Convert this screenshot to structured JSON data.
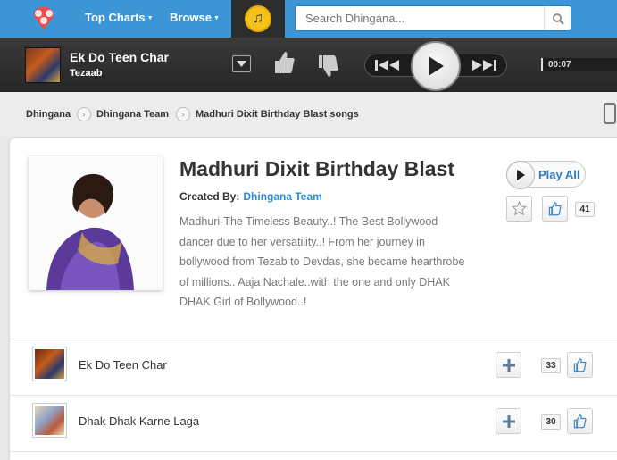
{
  "nav": {
    "top_charts": "Top Charts",
    "browse": "Browse",
    "search_placeholder": "Search Dhingana..."
  },
  "player": {
    "title": "Ek Do Teen Char",
    "artist": "Tezaab",
    "time": "00:07"
  },
  "breadcrumb": [
    "Dhingana",
    "Dhingana Team",
    "Madhuri Dixit Birthday Blast songs"
  ],
  "playlist": {
    "title": "Madhuri Dixit Birthday Blast",
    "created_by_label": "Created By:",
    "creator": "Dhingana Team",
    "description": "Madhuri-The Timeless Beauty..! The Best Bollywood dancer due to her versatility..! From her journey in bollywood from Tezab to Devdas, she became hearthrobe of millions.. Aaja Nachale..with the one and only DHAK DHAK Girl of Bollywood..!",
    "play_all": "Play All",
    "likes": "41"
  },
  "tracks": [
    {
      "name": "Ek Do Teen Char",
      "likes": "33"
    },
    {
      "name": "Dhak Dhak Karne Laga",
      "likes": "30"
    }
  ],
  "colors": {
    "brand_blue": "#3c96d6",
    "link_blue": "#2b8fd6",
    "accent_yellow": "#f5c21b"
  },
  "icons": [
    "logo-icon",
    "music-note-icon",
    "search-icon",
    "download-icon",
    "thumbs-up-icon",
    "thumbs-down-icon",
    "previous-icon",
    "play-icon",
    "next-icon",
    "mobile-device-icon",
    "star-icon",
    "add-icon"
  ]
}
